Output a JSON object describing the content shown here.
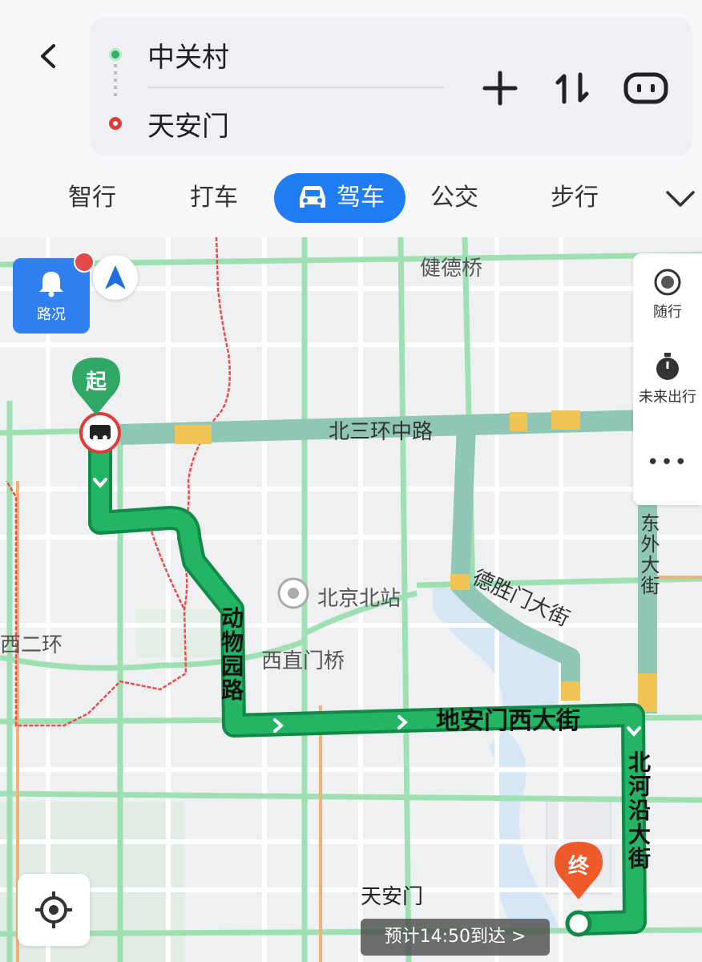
{
  "header": {
    "origin": "中关村",
    "destination": "天安门"
  },
  "modes": [
    {
      "label": "智行"
    },
    {
      "label": "打车"
    },
    {
      "label": "驾车",
      "active": true
    },
    {
      "label": "公交"
    },
    {
      "label": "步行"
    }
  ],
  "map": {
    "road_condition_label": "路况",
    "side": {
      "item1": "随行",
      "item2": "未来出行",
      "more": "•••"
    },
    "labels": {
      "top_bridge": "健德桥",
      "north_third_ring": "北三环中路",
      "west_bridge": "西直门桥",
      "beijing_north_station": "北京北站",
      "west_road": "西二环",
      "deshengmen": "德胜门大街",
      "di_an_men": "地安门西大街",
      "dongwai": "东外大街",
      "animal_road": "动物园路",
      "north_river": "北河沿大街",
      "tiananmen": "天安门",
      "start_pin": "起",
      "end_pin": "终"
    },
    "eta": "预计14:50到达 >"
  },
  "colors": {
    "accent": "#1f7cf3",
    "route": "#1aa55a",
    "start_pin": "#2fa866",
    "end_pin": "#ef5a2a"
  }
}
